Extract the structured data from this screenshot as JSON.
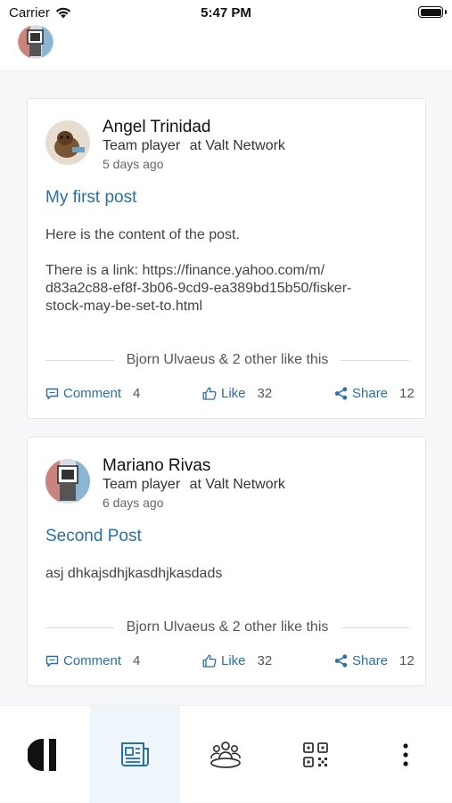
{
  "status_bar": {
    "carrier": "Carrier",
    "time": "5:47 PM"
  },
  "posts": [
    {
      "author": "Angel Trinidad",
      "role": "Team player",
      "company_prefix": "at",
      "company": "Valt Network",
      "time_ago": "5 days ago",
      "title": "My first post",
      "body_lines": [
        "Here is the content of the post.",
        "There is a link: https://finance.yahoo.com/m/",
        "d83a2c88-ef8f-3b06-9cd9-ea389bd15b50/fisker-",
        "stock-may-be-set-to.html"
      ],
      "likes_text": "Bjorn Ulvaeus & 2 other like this",
      "comment_label": "Comment",
      "comment_count": "4",
      "like_label": "Like",
      "like_count": "32",
      "share_label": "Share",
      "share_count": "12"
    },
    {
      "author": "Mariano Rivas",
      "role": "Team player",
      "company_prefix": "at",
      "company": "Valt Network",
      "time_ago": "6 days ago",
      "title": "Second Post",
      "body_lines": [
        "asj dhkajsdhjkasdhjkasdads"
      ],
      "likes_text": "Bjorn Ulvaeus & 2 other like this",
      "comment_label": "Comment",
      "comment_count": "4",
      "like_label": "Like",
      "like_count": "32",
      "share_label": "Share",
      "share_count": "12"
    }
  ],
  "tabs": [
    {
      "icon": "brand-logo-icon",
      "active": false
    },
    {
      "icon": "newspaper-icon",
      "active": true
    },
    {
      "icon": "people-icon",
      "active": false
    },
    {
      "icon": "qr-code-icon",
      "active": false
    },
    {
      "icon": "more-vertical-icon",
      "active": false
    }
  ],
  "colors": {
    "accent": "#2a6fa5",
    "active_tab_bg": "#eef5fb"
  }
}
